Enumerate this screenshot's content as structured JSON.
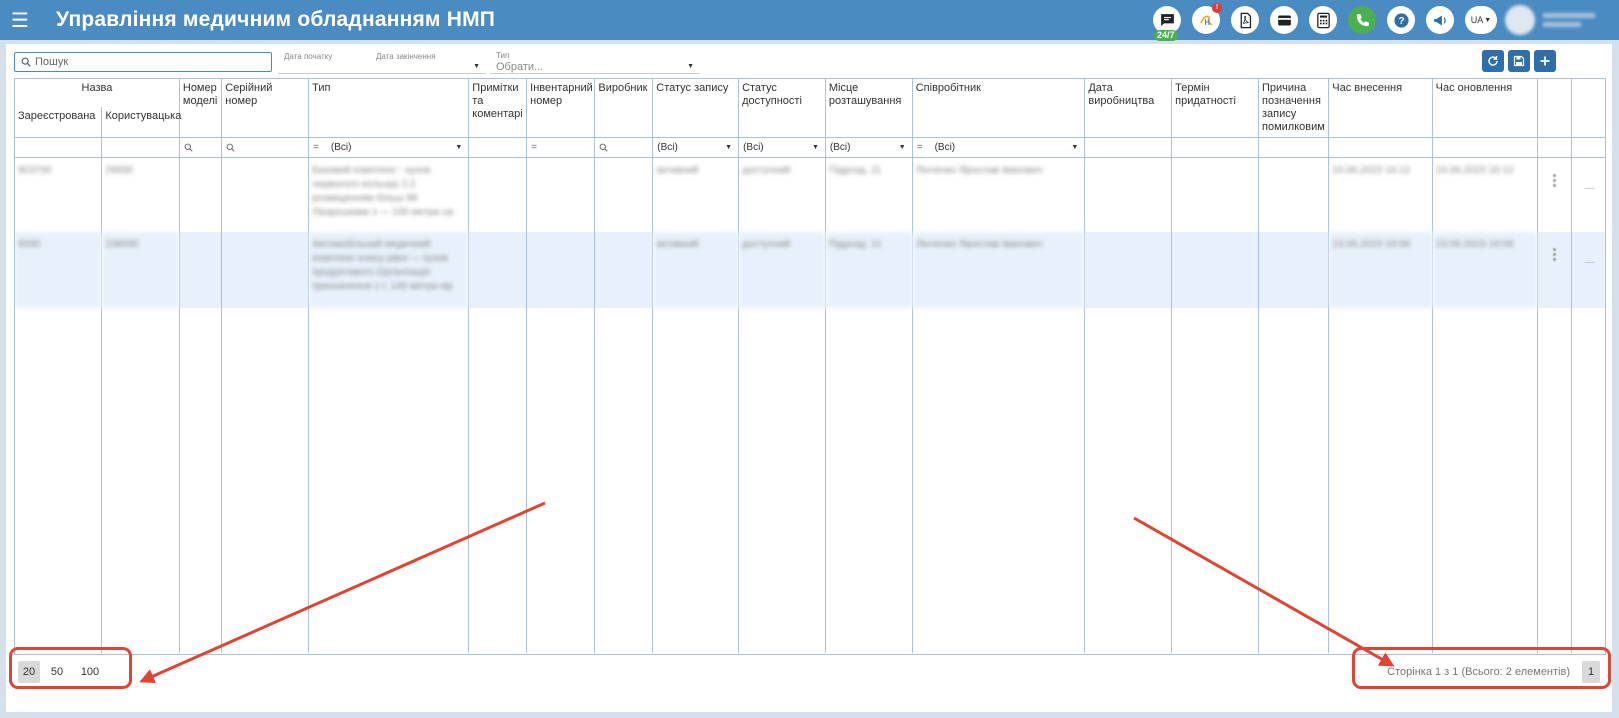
{
  "header": {
    "title": "Управління медичним обладнанням НМП",
    "support_badge": "24/7",
    "notify_badge": "!",
    "lang": "UA"
  },
  "toolbar": {
    "search_placeholder": "Пошук",
    "date_start_label": "Дата початку",
    "date_end_label": "Дата закінчення",
    "type_label": "Тип",
    "type_value": "Обрати..."
  },
  "grid": {
    "columns": {
      "name_group": "Назва",
      "registered": "Зареєстрована",
      "custom": "Користувацька",
      "model": "Номер моделі",
      "serial": "Серійний номер",
      "type": "Тип",
      "notes": "Примітки та коментарі",
      "inventory": "Інвентарний номер",
      "manufacturer": "Виробник",
      "record_status": "Статус запису",
      "availability": "Статус доступності",
      "location": "Місце розташування",
      "employee": "Співробітник",
      "production_date": "Дата виробництва",
      "expiry": "Термін придатності",
      "error_reason": "Причина позначення запису помилковим",
      "created": "Час внесення",
      "updated": "Час оновлення"
    },
    "filters": {
      "all": "(Всі)",
      "eq": "="
    },
    "rows": [
      {
        "registered": "903700",
        "custom": "29930",
        "type": "Базовий комплекс - кузов червоного кольору 2.2 розміщенням більш 98 Лікарськими з — 100 метри на",
        "record_status": "активний",
        "availability": "доступний",
        "location": "Підрозд. 11",
        "employee": "Лінченко Ярослав Іванович",
        "created": "24.06.2023 16:12",
        "updated": "24.06.2023 16:12"
      },
      {
        "registered": "9330",
        "custom": "238095",
        "type": "Автомобільний медичний комплекс класу рівні — кузов продуктивого Організація призначення з т. 140 метри кір",
        "record_status": "активний",
        "availability": "доступний",
        "location": "Підрозд. 11",
        "employee": "Лінченко Ярослав Іванович",
        "created": "23.06.2023 19:08",
        "updated": "23.06.2023 19:08"
      }
    ]
  },
  "pager": {
    "sizes": [
      "20",
      "50",
      "100"
    ],
    "info": "Сторінка 1 з 1 (Всього: 2 елементів)",
    "page": "1"
  },
  "colors": {
    "header": "#4a8bc2",
    "accent": "#2f6ea8",
    "annotation": "#e04433",
    "row_alt": "#e8f0fb"
  }
}
